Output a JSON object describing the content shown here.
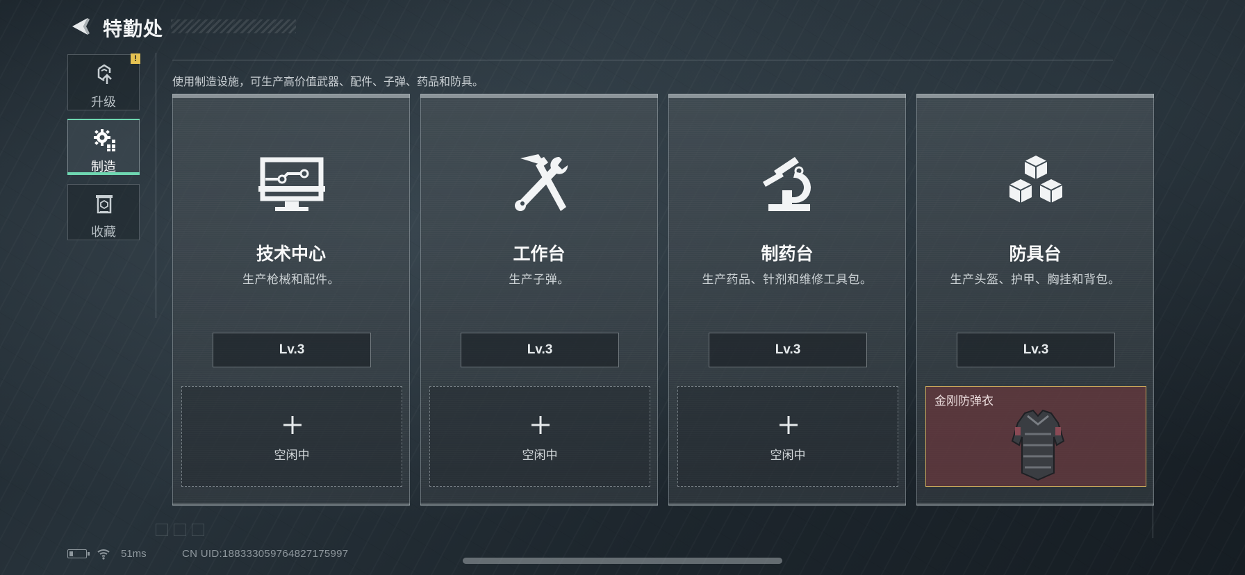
{
  "header": {
    "title": "特勤处",
    "back_icon": "back-arrow-icon"
  },
  "sidebar": {
    "items": [
      {
        "label": "升级",
        "icon": "upgrade-icon",
        "active": false,
        "badge": "!"
      },
      {
        "label": "制造",
        "icon": "gear-craft-icon",
        "active": true
      },
      {
        "label": "收藏",
        "icon": "collection-icon",
        "active": false
      }
    ]
  },
  "description": "使用制造设施，可生产高价值武器、配件、子弹、药品和防具。",
  "stations": [
    {
      "name": "技术中心",
      "desc": "生产枪械和配件。",
      "level": "Lv.3",
      "icon": "computer-monitor-icon",
      "slot": {
        "status": "空闲中"
      }
    },
    {
      "name": "工作台",
      "desc": "生产子弹。",
      "level": "Lv.3",
      "icon": "hammer-wrench-icon",
      "slot": {
        "status": "空闲中"
      }
    },
    {
      "name": "制药台",
      "desc": "生产药品、针剂和维修工具包。",
      "level": "Lv.3",
      "icon": "microscope-icon",
      "slot": {
        "status": "空闲中"
      }
    },
    {
      "name": "防具台",
      "desc": "生产头盔、护甲、胸挂和背包。",
      "level": "Lv.3",
      "icon": "stacked-cubes-icon",
      "slot": {
        "item": "金刚防弹衣",
        "item_icon": "body-armor-vest-icon"
      }
    }
  ],
  "colors": {
    "accent": "#6fd6b1",
    "badge": "#e6c252",
    "busy_slot": "#6e373c",
    "busy_border": "#c9a75a"
  },
  "footer": {
    "ping": "51ms",
    "uid": "CN UID:1883330597648271759​97"
  }
}
